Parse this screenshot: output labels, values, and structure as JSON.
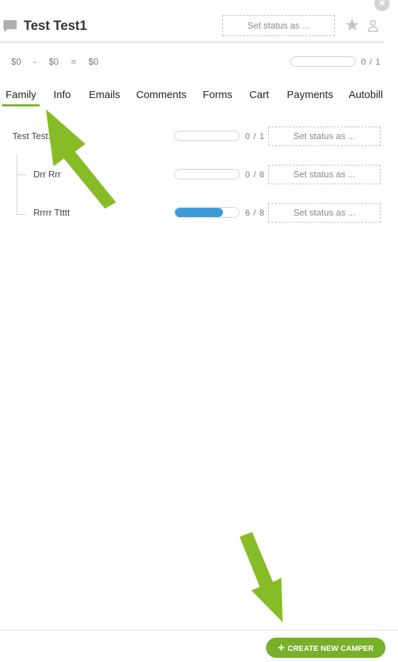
{
  "header": {
    "family_name": "Test Test1",
    "status_placeholder": "Set status as ...",
    "icons": [
      "chat-icon",
      "star-icon",
      "person-icon",
      "close-icon"
    ]
  },
  "summary": {
    "amount1": "$0",
    "op1": "-",
    "amount2": "$0",
    "op2": "=",
    "total": "$0",
    "progress_count": "0 / 1",
    "progress_fraction": 0
  },
  "tabs": [
    {
      "label": "Family",
      "active": true
    },
    {
      "label": "Info"
    },
    {
      "label": "Emails"
    },
    {
      "label": "Comments"
    },
    {
      "label": "Forms"
    },
    {
      "label": "Cart"
    },
    {
      "label": "Payments"
    },
    {
      "label": "Autobill"
    }
  ],
  "members": [
    {
      "name": "Test Test1",
      "count": "0 / 1",
      "progress_fraction": 0,
      "status": "Set status as ..."
    },
    {
      "name": "Drr Rrr",
      "count": "0 / 8",
      "progress_fraction": 0,
      "status": "Set status as ..."
    },
    {
      "name": "Rrrrr Ttttt",
      "count": "6 / 8",
      "progress_fraction": 0.75,
      "status": "Set status as ..."
    }
  ],
  "footer": {
    "create_button": "CREATE NEW CAMPER"
  },
  "colors": {
    "accent_green": "#77b02a",
    "progress_blue": "#3d9ad8",
    "annotation_arrow": "#86bc25"
  }
}
